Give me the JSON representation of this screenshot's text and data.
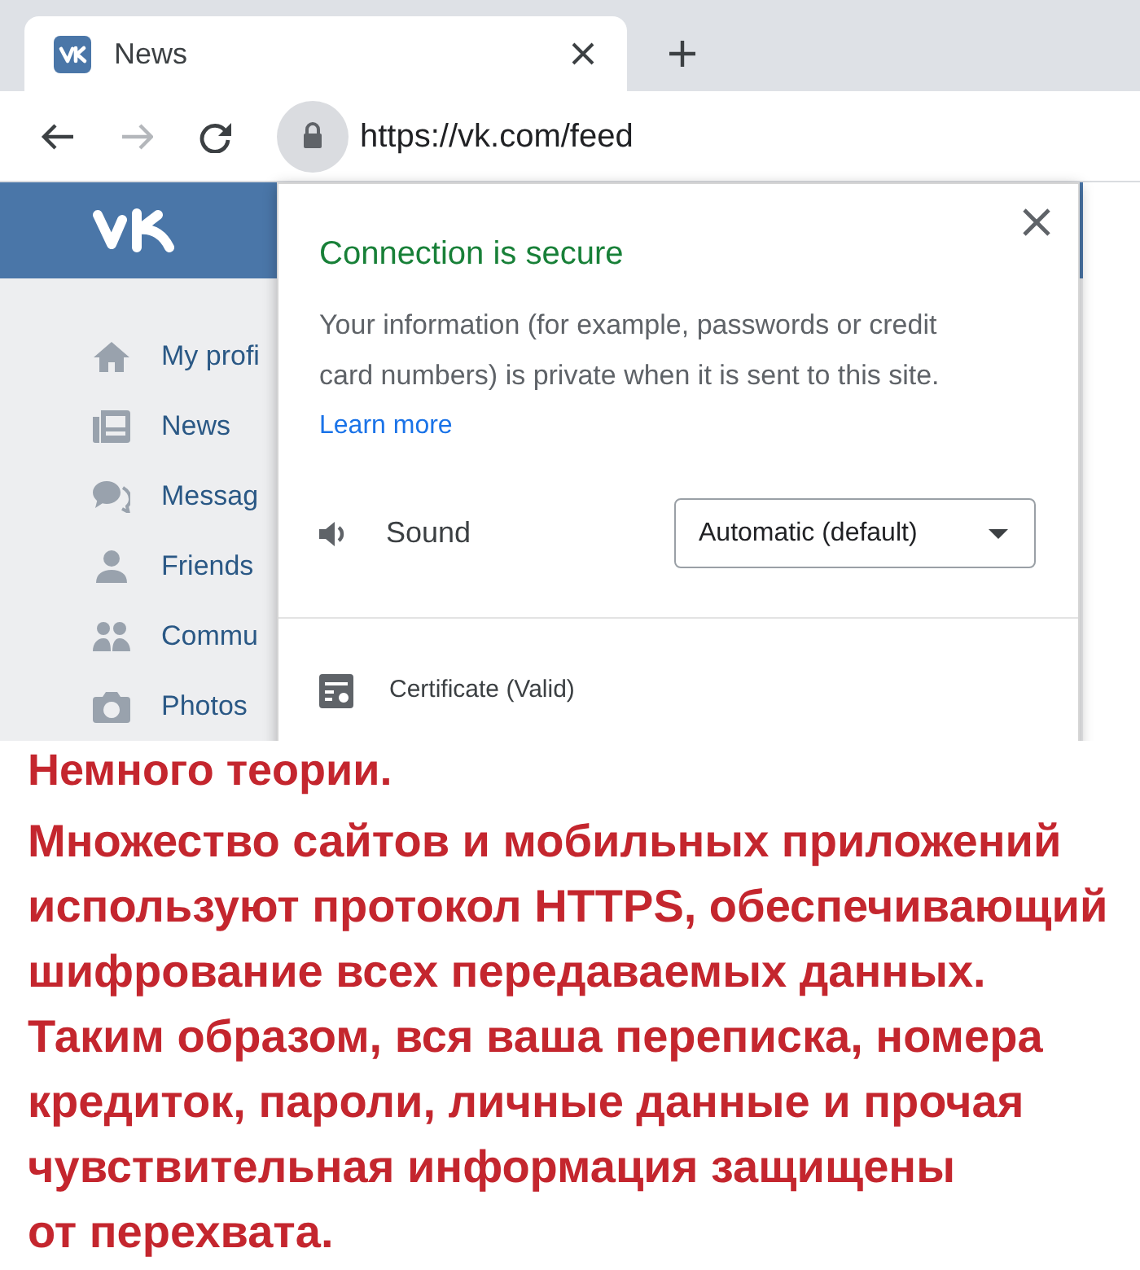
{
  "browser": {
    "tabs": [
      {
        "title": "News",
        "selected": true
      }
    ],
    "nav_buttons": [
      {
        "disabled": false
      },
      {
        "disabled": true
      },
      {
        "disabled": false
      }
    ],
    "address_bar": {
      "url": "https://vk.com/feed"
    }
  },
  "sidebar": {
    "items": [
      {
        "label": "My profi"
      },
      {
        "label": "News"
      },
      {
        "label": "Messag"
      },
      {
        "label": "Friends"
      },
      {
        "label": "Commu"
      },
      {
        "label": "Photos"
      }
    ]
  },
  "site_info_popup": {
    "title": "Connection is secure",
    "description": "Your information (for example, passwords or credit card numbers) is private when it is sent to this site.",
    "link": "Learn more",
    "permissions": [
      {
        "label": "Sound",
        "value": "Automatic (default)"
      }
    ],
    "certificate": "Certificate (Valid)"
  },
  "article": {
    "heading": "Немного теории.",
    "body": "Множество сайтов и мобильных приложений\nиспользуют протокол HTTPS, обеспечивающий\nшифрование всех передаваемых данных.\nТаким образом, вся ваша переписка, номера\nкредиток, пароли, личные данные и прочая\nчувствительная информация защищены\nот перехвата."
  }
}
